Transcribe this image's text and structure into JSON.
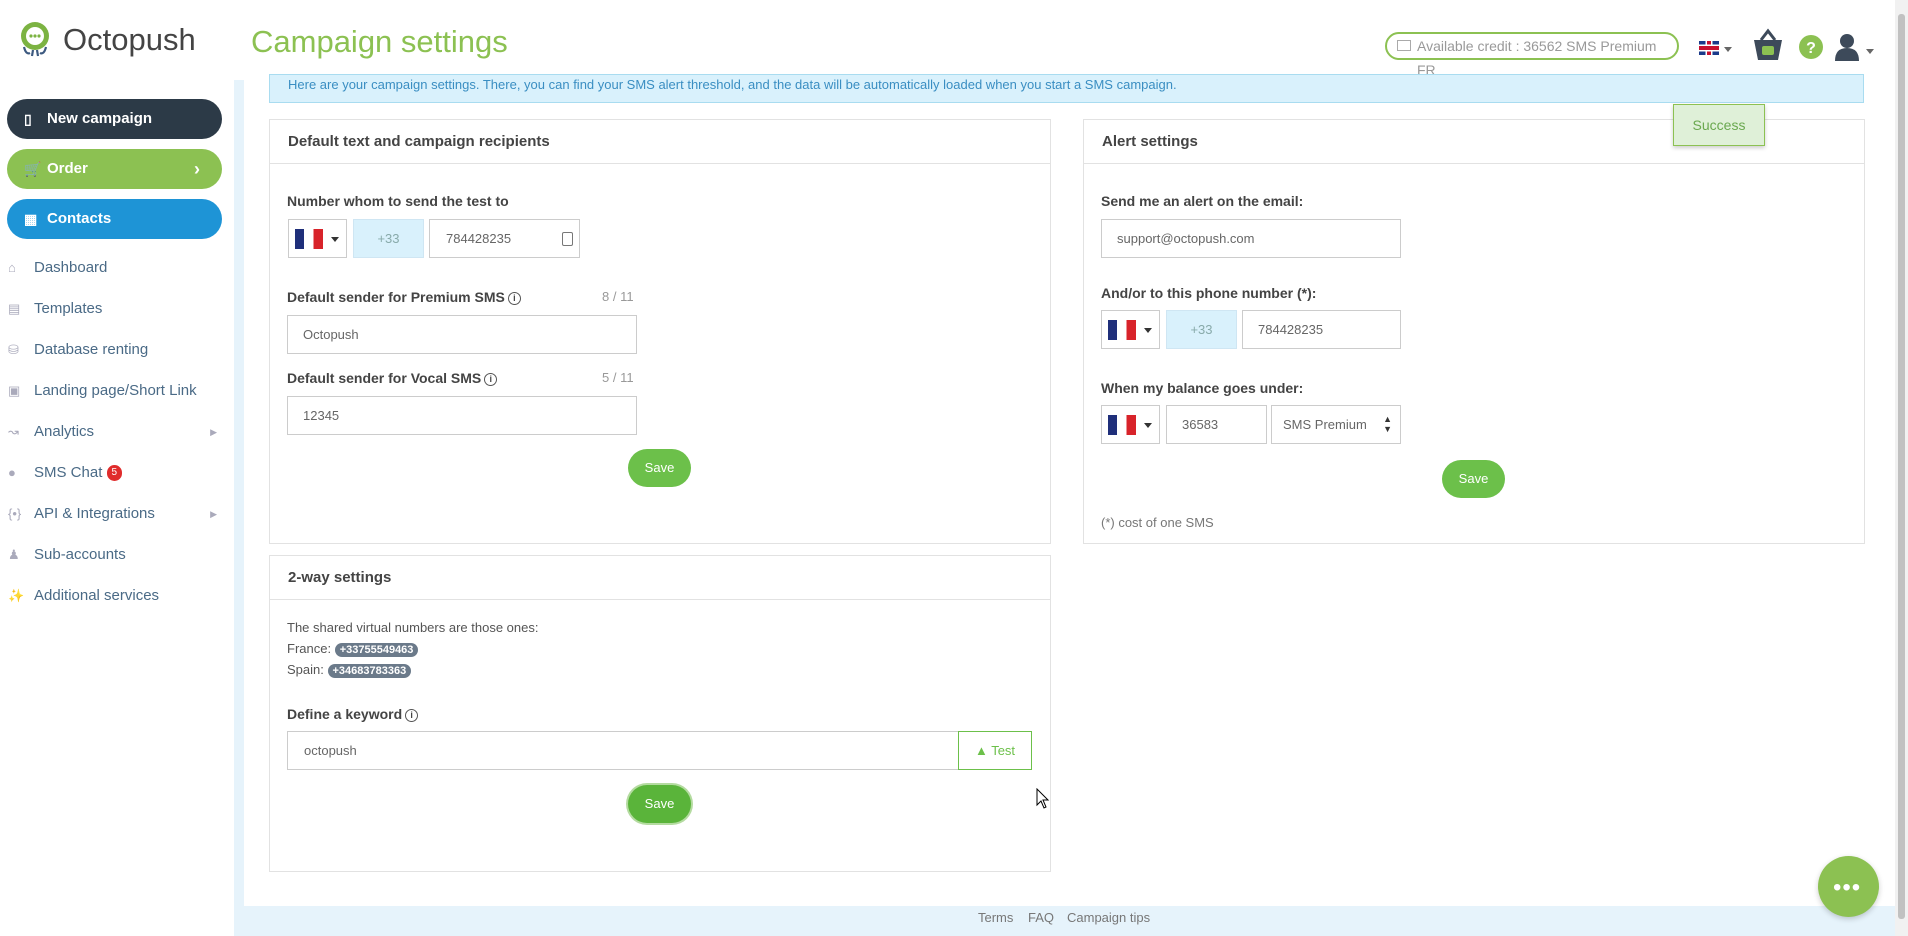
{
  "header": {
    "brand": "Octopush",
    "page_title": "Campaign settings",
    "credit": "Available credit : 36562 SMS Premium FR"
  },
  "sidebar": {
    "new_campaign": "New campaign",
    "order": "Order",
    "contacts": "Contacts",
    "items": [
      {
        "label": "Dashboard"
      },
      {
        "label": "Templates"
      },
      {
        "label": "Database renting"
      },
      {
        "label": "Landing page/Short Link"
      },
      {
        "label": "Analytics"
      },
      {
        "label": "SMS Chat",
        "badge": "5"
      },
      {
        "label": "API & Integrations"
      },
      {
        "label": "Sub-accounts"
      },
      {
        "label": "Additional services"
      }
    ]
  },
  "info_bar": "Here are your campaign settings. There, you can find your SMS alert threshold, and the data will be automatically loaded when you start a SMS campaign.",
  "toast": "Success",
  "default_panel": {
    "title": "Default text and campaign recipients",
    "test_label": "Number whom to send the test to",
    "test_prefix": "+33",
    "test_number": "784428235",
    "premium_label": "Default sender for Premium SMS",
    "premium_count": "8 / 11",
    "premium_value": "Octopush",
    "vocal_label": "Default sender for Vocal SMS",
    "vocal_count": "5 / 11",
    "vocal_value": "12345",
    "save": "Save"
  },
  "twoway_panel": {
    "title": "2-way settings",
    "shared_text": "The shared virtual numbers are those ones:",
    "france_label": "France:",
    "france_number": "+33755549463",
    "spain_label": "Spain:",
    "spain_number": "+34683783363",
    "keyword_label": "Define a keyword",
    "keyword_value": "octopush",
    "test_button": "Test",
    "save": "Save"
  },
  "alert_panel": {
    "title": "Alert settings",
    "email_label": "Send me an alert on the email:",
    "email_value": "support@octopush.com",
    "phone_label": "And/or to this phone number (*):",
    "phone_prefix": "+33",
    "phone_number": "784428235",
    "balance_label": "When my balance goes under:",
    "balance_value": "36583",
    "balance_unit": "SMS Premium",
    "save": "Save",
    "note": "(*) cost of one SMS"
  },
  "footer": {
    "terms": "Terms",
    "faq": "FAQ",
    "tips": "Campaign tips"
  }
}
